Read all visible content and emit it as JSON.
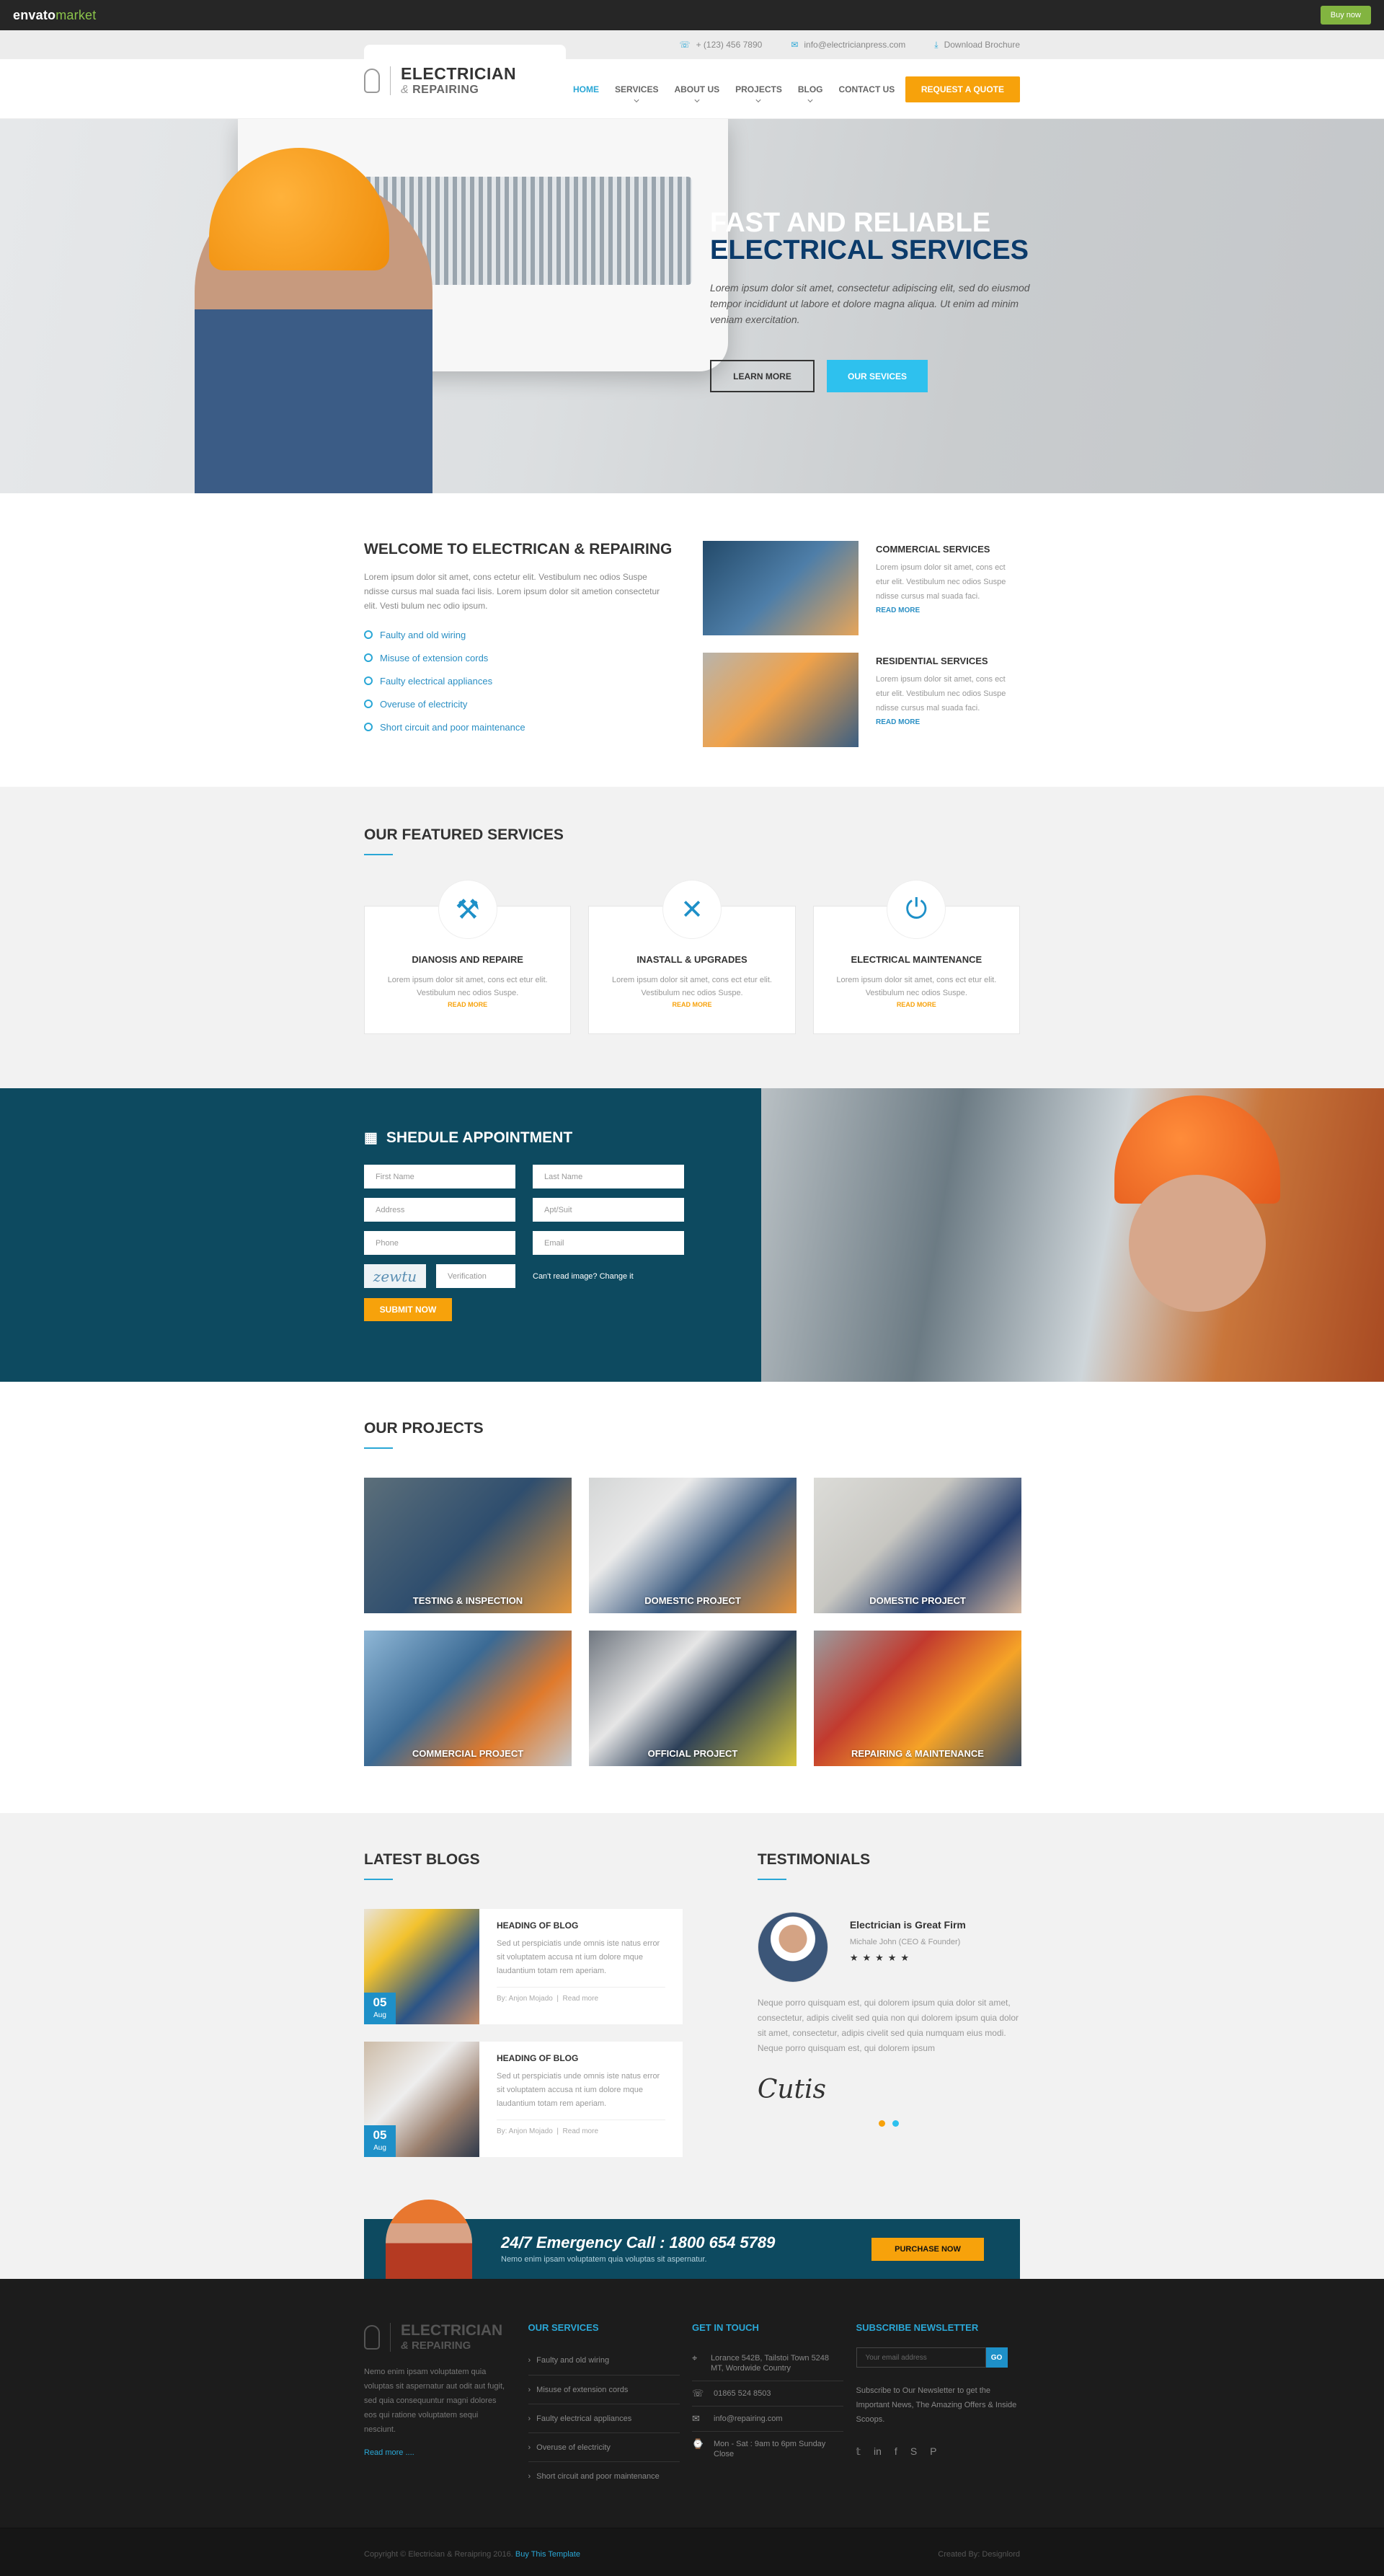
{
  "envato": {
    "logo_prefix": "envato",
    "logo_suffix": "market",
    "buy_label": "Buy now"
  },
  "topbar": {
    "phone": "+ (123) 456 7890",
    "email": "info@electricianpress.com",
    "brochure": "Download Brochure"
  },
  "brand": {
    "line1": "ELECTRICIAN",
    "amp": "&",
    "line2": "REPAIRING"
  },
  "nav": {
    "items": [
      "HOME",
      "SERVICES",
      "ABOUT US",
      "PROJECTS",
      "BLOG",
      "CONTACT US"
    ],
    "quote_label": "REQUEST A QUOTE"
  },
  "hero": {
    "title_line1": "FAST AND RELIABLE",
    "title_line2": "ELECTRICAL SERVICES",
    "text": "Lorem ipsum dolor sit amet, consectetur adipiscing elit, sed do eiusmod tempor incididunt ut labore et dolore magna aliqua. Ut enim ad minim veniam exercitation.",
    "learn_more": "LEARN MORE",
    "our_services": "OUR SEVICES"
  },
  "welcome": {
    "title": "WELCOME TO ELECTRICAN & REPAIRING",
    "text": "Lorem ipsum dolor sit amet, cons ectetur elit. Vestibulum nec odios Suspe ndisse cursus mal suada faci lisis. Lorem ipsum dolor sit ametion consectetur elit. Vesti bulum nec odio ipsum.",
    "features": [
      "Faulty and old wiring",
      "Misuse of extension cords",
      "Faulty electrical appliances",
      "Overuse of electricity",
      "Short circuit and poor maintenance"
    ],
    "services": [
      {
        "title": "COMMERCIAL SERVICES",
        "text": "Lorem ipsum dolor sit amet, cons ect etur elit. Vestibulum nec odios Suspe ndisse cursus mal suada faci.",
        "read_more": "READ MORE"
      },
      {
        "title": "RESIDENTIAL SERVICES",
        "text": "Lorem ipsum dolor sit amet, cons ect etur elit. Vestibulum nec odios Suspe ndisse cursus mal suada faci.",
        "read_more": "READ MORE"
      }
    ]
  },
  "featured": {
    "title": "OUR FEATURED SERVICES",
    "cards": [
      {
        "title": "DIANOSIS AND REPAIRE",
        "text": "Lorem ipsum dolor sit amet, cons ect etur elit. Vestibulum nec odios Suspe.",
        "read_more": "READ MORE"
      },
      {
        "title": "INASTALL & UPGRADES",
        "text": "Lorem ipsum dolor sit amet, cons ect etur elit. Vestibulum nec odios Suspe.",
        "read_more": "READ MORE"
      },
      {
        "title": "ELECTRICAL MAINTENANCE",
        "text": "Lorem ipsum dolor sit amet, cons ect etur elit. Vestibulum nec odios Suspe.",
        "read_more": "READ MORE"
      }
    ]
  },
  "appointment": {
    "title": "SHEDULE APPOINTMENT",
    "first_name": "First Name",
    "last_name": "Last Name",
    "address": "Address",
    "apt": "Apt/Suit",
    "phone": "Phone",
    "email": "Email",
    "captcha": "zewtu",
    "verification": "Verification",
    "change": "Can't read image? Change it",
    "submit": "SUBMIT NOW"
  },
  "projects": {
    "title": "OUR PROJECTS",
    "items": [
      "TESTING & INSPECTION",
      "DOMESTIC PROJECT",
      "DOMESTIC PROJECT",
      "COMMERCIAL PROJECT",
      "OFFICIAL PROJECT",
      "REPAIRING & MAINTENANCE"
    ]
  },
  "blogs": {
    "title": "LATEST BLOGS",
    "items": [
      {
        "day": "05",
        "month": "Aug",
        "title": "HEADING OF BLOG",
        "text": "Sed ut perspiciatis unde omnis iste natus error sit voluptatem accusa nt ium dolore mque laudantium totam rem aperiam.",
        "author": "By: Anjon Mojado",
        "read": "Read more"
      },
      {
        "day": "05",
        "month": "Aug",
        "title": "HEADING OF BLOG",
        "text": "Sed ut perspiciatis unde omnis iste natus error sit voluptatem accusa nt ium dolore mque laudantium totam rem aperiam.",
        "author": "By: Anjon Mojado",
        "read": "Read more"
      }
    ]
  },
  "testimonials": {
    "title": "TESTIMONIALS",
    "heading": "Electrician is Great Firm",
    "role": "Michale John (CEO & Founder)",
    "stars": "★★★★★",
    "text": "Neque porro quisquam est, qui dolorem ipsum quia dolor sit amet, consectetur, adipis civelit sed quia non qui dolorem ipsum quia dolor sit amet, consectetur, adipis civelit sed quia numquam eius modi. Neque porro quisquam est, qui dolorem ipsum",
    "signature": "Cutis"
  },
  "emergency": {
    "title": "24/7 Emergency Call : 1800 654 5789",
    "subtitle": "Nemo enim ipsam voluptatem quia voluptas sit aspernatur.",
    "button": "PURCHASE NOW"
  },
  "footer": {
    "about": "Nemo enim ipsam voluptatem quia voluptas sit aspernatur aut odit aut fugit, sed quia consequuntur magni dolores eos qui ratione voluptatem sequi nesciunt.",
    "read_more": "Read more ....",
    "services_title": "OUR SERVICES",
    "services": [
      "Faulty and old wiring",
      "Misuse of extension cords",
      "Faulty electrical appliances",
      "Overuse of electricity",
      "Short circuit and poor maintenance"
    ],
    "touch_title": "GET IN TOUCH",
    "address": "Lorance 542B, Tailstoi Town 5248 MT, Wordwide Country",
    "phone": "01865 524 8503",
    "email": "info@repairing.com",
    "hours": "Mon - Sat : 9am to 6pm Sunday Close",
    "newsletter_title": "SUBSCRIBE NEWSLETTER",
    "newsletter_placeholder": "Your email address",
    "go": "GO",
    "newsletter_text": "Subscribe to Our Newsletter to get the Important News, The Amazing Offers & Inside Scoops."
  },
  "bottom": {
    "copyright": "Copyright © Electrician & Reraipring 2016.",
    "buy": "Buy This Template",
    "credit": "Created By: Designlord"
  }
}
